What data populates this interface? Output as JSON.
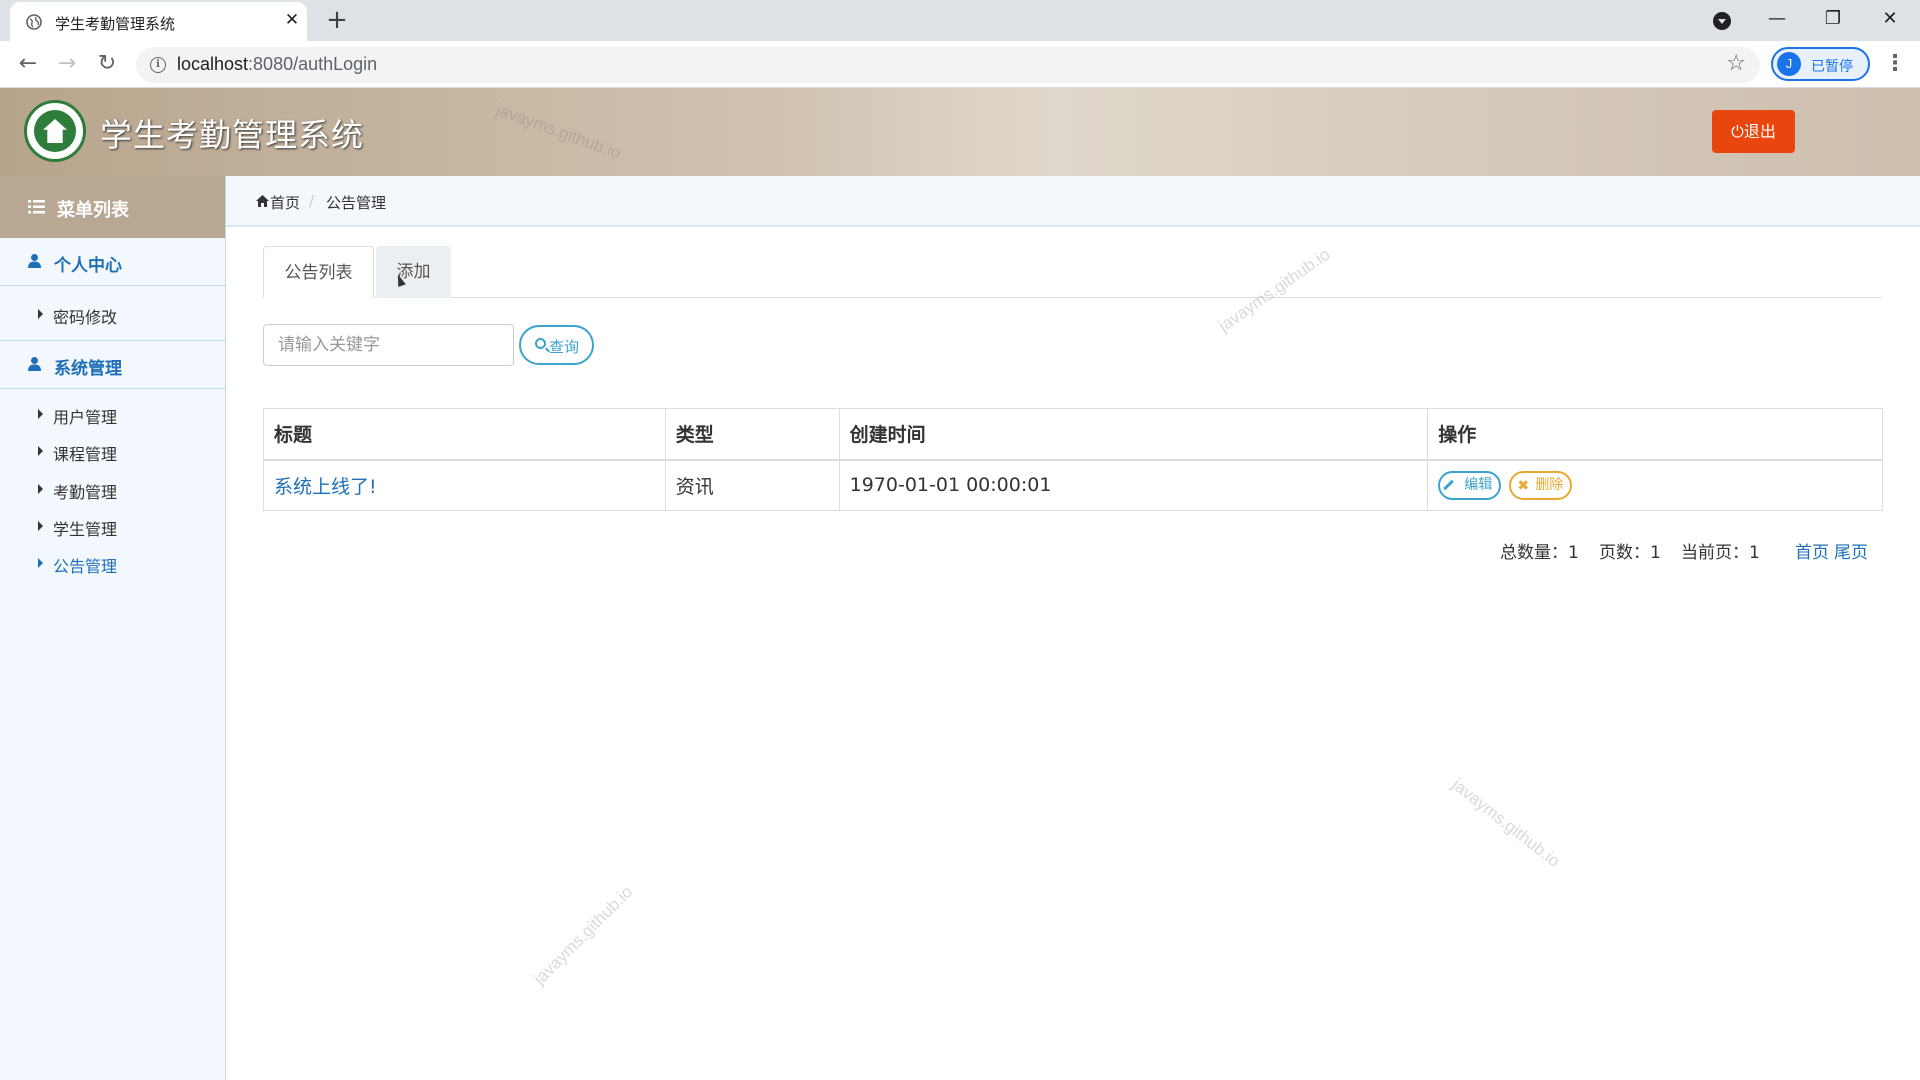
{
  "browser": {
    "tab_title": "学生考勤管理系统",
    "url_host": "localhost",
    "url_path": ":8080/authLogin",
    "profile_initial": "J",
    "profile_label": "已暂停"
  },
  "header": {
    "app_title": "学生考勤管理系统",
    "logout_label": "退出"
  },
  "sidebar": {
    "title": "菜单列表",
    "groups": [
      {
        "label": "个人中心",
        "items": [
          {
            "label": "密码修改"
          }
        ]
      },
      {
        "label": "系统管理",
        "items": [
          {
            "label": "用户管理"
          },
          {
            "label": "课程管理"
          },
          {
            "label": "考勤管理"
          },
          {
            "label": "学生管理"
          },
          {
            "label": "公告管理",
            "active": true
          }
        ]
      }
    ]
  },
  "breadcrumb": {
    "home": "首页",
    "current": "公告管理"
  },
  "tabs": {
    "list": "公告列表",
    "add": "添加"
  },
  "search": {
    "placeholder": "请输入关键字",
    "value": "",
    "button": "查询"
  },
  "table": {
    "columns": [
      "标题",
      "类型",
      "创建时间",
      "操作"
    ],
    "rows": [
      {
        "title": "系统上线了!",
        "type": "资讯",
        "created": "1970-01-01 00:00:01",
        "edit": "编辑",
        "delete": "删除"
      }
    ]
  },
  "pager": {
    "total_label": "总数量：1",
    "pages_label": "页数：1",
    "current_label": "当前页：1",
    "first": "首页",
    "last": "尾页"
  },
  "watermark": "javayms.github.io",
  "colors": {
    "accent_blue": "#1e6fb8",
    "logout_red": "#e8450f",
    "edit_blue": "#3ba3d0",
    "delete_orange": "#e8a930"
  }
}
